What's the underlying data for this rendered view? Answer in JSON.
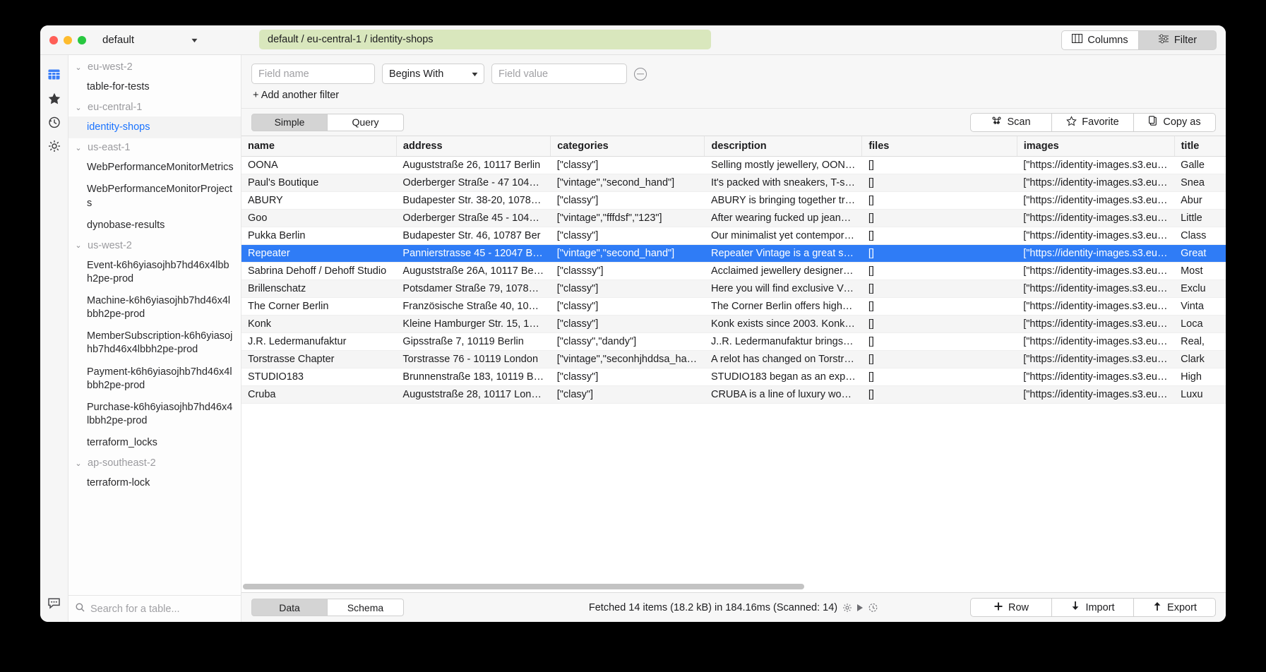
{
  "window": {
    "profile": "default",
    "profile_caret": "▼",
    "breadcrumb": "default / eu-central-1 / identity-shops",
    "breadcrumb_bg": "#d9e7bd",
    "columns_button": "Columns",
    "filter_button": "Filter"
  },
  "rail": {
    "items": [
      {
        "icon": "table-grid-icon",
        "active": true
      },
      {
        "icon": "star-icon",
        "active": false
      },
      {
        "icon": "history-clock-icon",
        "active": false
      },
      {
        "icon": "gear-icon",
        "active": false
      }
    ],
    "bottom_icon": "chat-bubble-icon",
    "active_color": "#3b7ff7"
  },
  "sidebar": {
    "search_placeholder": "Search for a table...",
    "search_icon": "search-icon",
    "selected_table": "identity-shops",
    "groups": [
      {
        "region": "eu-west-2",
        "chevron": "⌄",
        "tables": [
          "table-for-tests"
        ]
      },
      {
        "region": "eu-central-1",
        "chevron": "⌄",
        "tables": [
          "identity-shops"
        ]
      },
      {
        "region": "us-east-1",
        "chevron": "⌄",
        "tables": [
          "WebPerformanceMonitorMetrics",
          "WebPerformanceMonitorProjects",
          "dynobase-results"
        ]
      },
      {
        "region": "us-west-2",
        "chevron": "⌄",
        "tables": [
          "Event-k6h6yiasojhb7hd46x4lbbh2pe-prod",
          "Machine-k6h6yiasojhb7hd46x4lbbh2pe-prod",
          "MemberSubscription-k6h6yiasojhb7hd46x4lbbh2pe-prod",
          "Payment-k6h6yiasojhb7hd46x4lbbh2pe-prod",
          "Purchase-k6h6yiasojhb7hd46x4lbbh2pe-prod",
          "terraform_locks"
        ]
      },
      {
        "region": "ap-southeast-2",
        "chevron": "⌄",
        "tables": [
          "terraform-lock"
        ]
      }
    ]
  },
  "filter": {
    "field_name_placeholder": "Field name",
    "field_name_value": "",
    "operator_value": "Begins With",
    "operator_caret": "▼",
    "field_value_placeholder": "Field value",
    "field_value_value": "",
    "remove_icon": "minus-circle-icon",
    "add_another": "+ Add another filter"
  },
  "modebar": {
    "modes": [
      {
        "label": "Simple",
        "active": true
      },
      {
        "label": "Query",
        "active": false
      }
    ],
    "actions": [
      {
        "label": "Scan",
        "icon": "command-key-icon"
      },
      {
        "label": "Favorite",
        "icon": "star-outline-icon"
      },
      {
        "label": "Copy as",
        "icon": "clipboard-icon"
      }
    ]
  },
  "table": {
    "columns": [
      "name",
      "address",
      "categories",
      "description",
      "files",
      "images",
      "title"
    ],
    "selected_row_index": 5,
    "selected_row_color": "#2f7cf6",
    "rows": [
      {
        "name": "OONA",
        "address": "Auguststraße 26, 10117 Berlin",
        "categories": "[\"classy\"]",
        "description": "Selling mostly jewellery, OONA ...",
        "files": "[]",
        "images": "[\"https://identity-images.s3.eu-...",
        "title": "Galle"
      },
      {
        "name": "Paul's Boutique",
        "address": "Oderberger Straße - 47 10435 ...",
        "categories": "[\"vintage\",\"second_hand\"]",
        "description": "It's packed with sneakers, T-shi...",
        "files": "[]",
        "images": "[\"https://identity-images.s3.eu-...",
        "title": "Snea"
      },
      {
        "name": "ABURY",
        "address": "Budapester Str. 38-20, 10787 B...",
        "categories": "[\"classy\"]",
        "description": "ABURY is bringing together tra...",
        "files": "[]",
        "images": "[\"https://identity-images.s3.eu-...",
        "title": "Abur"
      },
      {
        "name": "Goo",
        "address": "Oderberger Straße 45 - 10435 ...",
        "categories": "[\"vintage\",\"fffdsf\",\"123\"]",
        "description": "After wearing fucked up jeans a...",
        "files": "[]",
        "images": "[\"https://identity-images.s3.eu-...",
        "title": "Little"
      },
      {
        "name": "Pukka Berlin",
        "address": "Budapester Str. 46, 10787 Ber",
        "categories": "[\"classy\"]",
        "description": "Our minimalist yet contemporar...",
        "files": "[]",
        "images": "[\"https://identity-images.s3.eu-...",
        "title": "Class"
      },
      {
        "name": "Repeater",
        "address": "Pannierstrasse 45 - 12047 Berli",
        "categories": "[\"vintage\",\"second_hand\"]",
        "description": "Repeater Vintage is a great sec...",
        "files": "[]",
        "images": "[\"https://identity-images.s3.eu-...",
        "title": "Great"
      },
      {
        "name": "Sabrina Dehoff / Dehoff Studio",
        "address": "Auguststraße 26A, 10117 Berlin",
        "categories": "[\"classsy\"]",
        "description": "Acclaimed jewellery designer S...",
        "files": "[]",
        "images": "[\"https://identity-images.s3.eu-...",
        "title": "Most"
      },
      {
        "name": "Brillenschatz",
        "address": "Potsdamer Straße 79, 10785 B...",
        "categories": "[\"classy\"]",
        "description": "Here you will find exclusive Vint...",
        "files": "[]",
        "images": "[\"https://identity-images.s3.eu-...",
        "title": "Exclu"
      },
      {
        "name": "The Corner Berlin",
        "address": "Französische Straße 40, 101 17 ...",
        "categories": "[\"classy\"]",
        "description": "The Corner Berlin offers high-e...",
        "files": "[]",
        "images": "[\"https://identity-images.s3.eu-...",
        "title": "Vinta"
      },
      {
        "name": "Konk",
        "address": "Kleine Hamburger Str. 15, 10117...",
        "categories": "[\"classy\"]",
        "description": "Konk exists since 2003. Konk is...",
        "files": "[]",
        "images": "[\"https://identity-images.s3.eu-...",
        "title": "Loca"
      },
      {
        "name": "J.R. Ledermanufaktur",
        "address": "Gipsstraße 7, 10119 Berlin",
        "categories": "[\"classy\",\"dandy\"]",
        "description": "J..R. Ledermanufaktur brings y...",
        "files": "[]",
        "images": "[\"https://identity-images.s3.eu-...",
        "title": "Real,"
      },
      {
        "name": "Torstrasse Chapter",
        "address": "Torstrasse 76 - 10119 London",
        "categories": "[\"vintage\",\"seconhjhddsa_hajkn...",
        "description": "A relot has changed on Torstra...",
        "files": "[]",
        "images": "[\"https://identity-images.s3.eu-...",
        "title": "Clark"
      },
      {
        "name": "STUDIO183",
        "address": "Brunnenstraße 183, 10119 Berlin",
        "categories": "[\"classy\"]",
        "description": "STUDIO183 began as an experi...",
        "files": "[]",
        "images": "[\"https://identity-images.s3.eu-...",
        "title": "High"
      },
      {
        "name": "Cruba",
        "address": "Auguststraße 28, 10117 London",
        "categories": "[\"clasy\"]",
        "description": "CRUBA is a line of luxury wome...",
        "files": "[]",
        "images": "[\"https://identity-images.s3.eu-...",
        "title": "Luxu"
      }
    ]
  },
  "footer": {
    "tabs": [
      {
        "label": "Data",
        "active": true
      },
      {
        "label": "Schema",
        "active": false
      }
    ],
    "status_text": "Fetched 14 items (18.2 kB) in 184.16ms (Scanned: 14)",
    "status_icons": [
      "gear-icon",
      "play-icon",
      "refresh-clock-icon"
    ],
    "actions": [
      {
        "label": "Row",
        "icon": "plus-icon"
      },
      {
        "label": "Import",
        "icon": "arrow-down-icon"
      },
      {
        "label": "Export",
        "icon": "arrow-up-icon"
      }
    ]
  }
}
